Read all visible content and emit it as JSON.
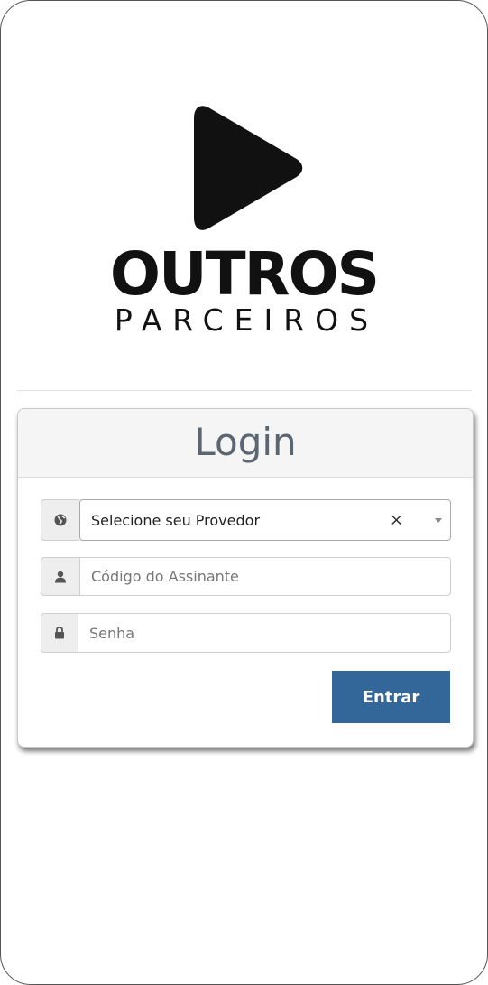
{
  "logo": {
    "title": "OUTROS",
    "subtitle": "PARCEIROS",
    "icon": "play-icon",
    "color": "#111111"
  },
  "login": {
    "heading": "Login",
    "provider": {
      "icon": "globe-icon",
      "selected": "Selecione seu Provedor",
      "clear": "×"
    },
    "subscriber": {
      "icon": "user-icon",
      "placeholder": "Código do Assinante"
    },
    "password": {
      "icon": "lock-icon",
      "placeholder": "Senha"
    },
    "submit_label": "Entrar",
    "accent": "#336699"
  }
}
